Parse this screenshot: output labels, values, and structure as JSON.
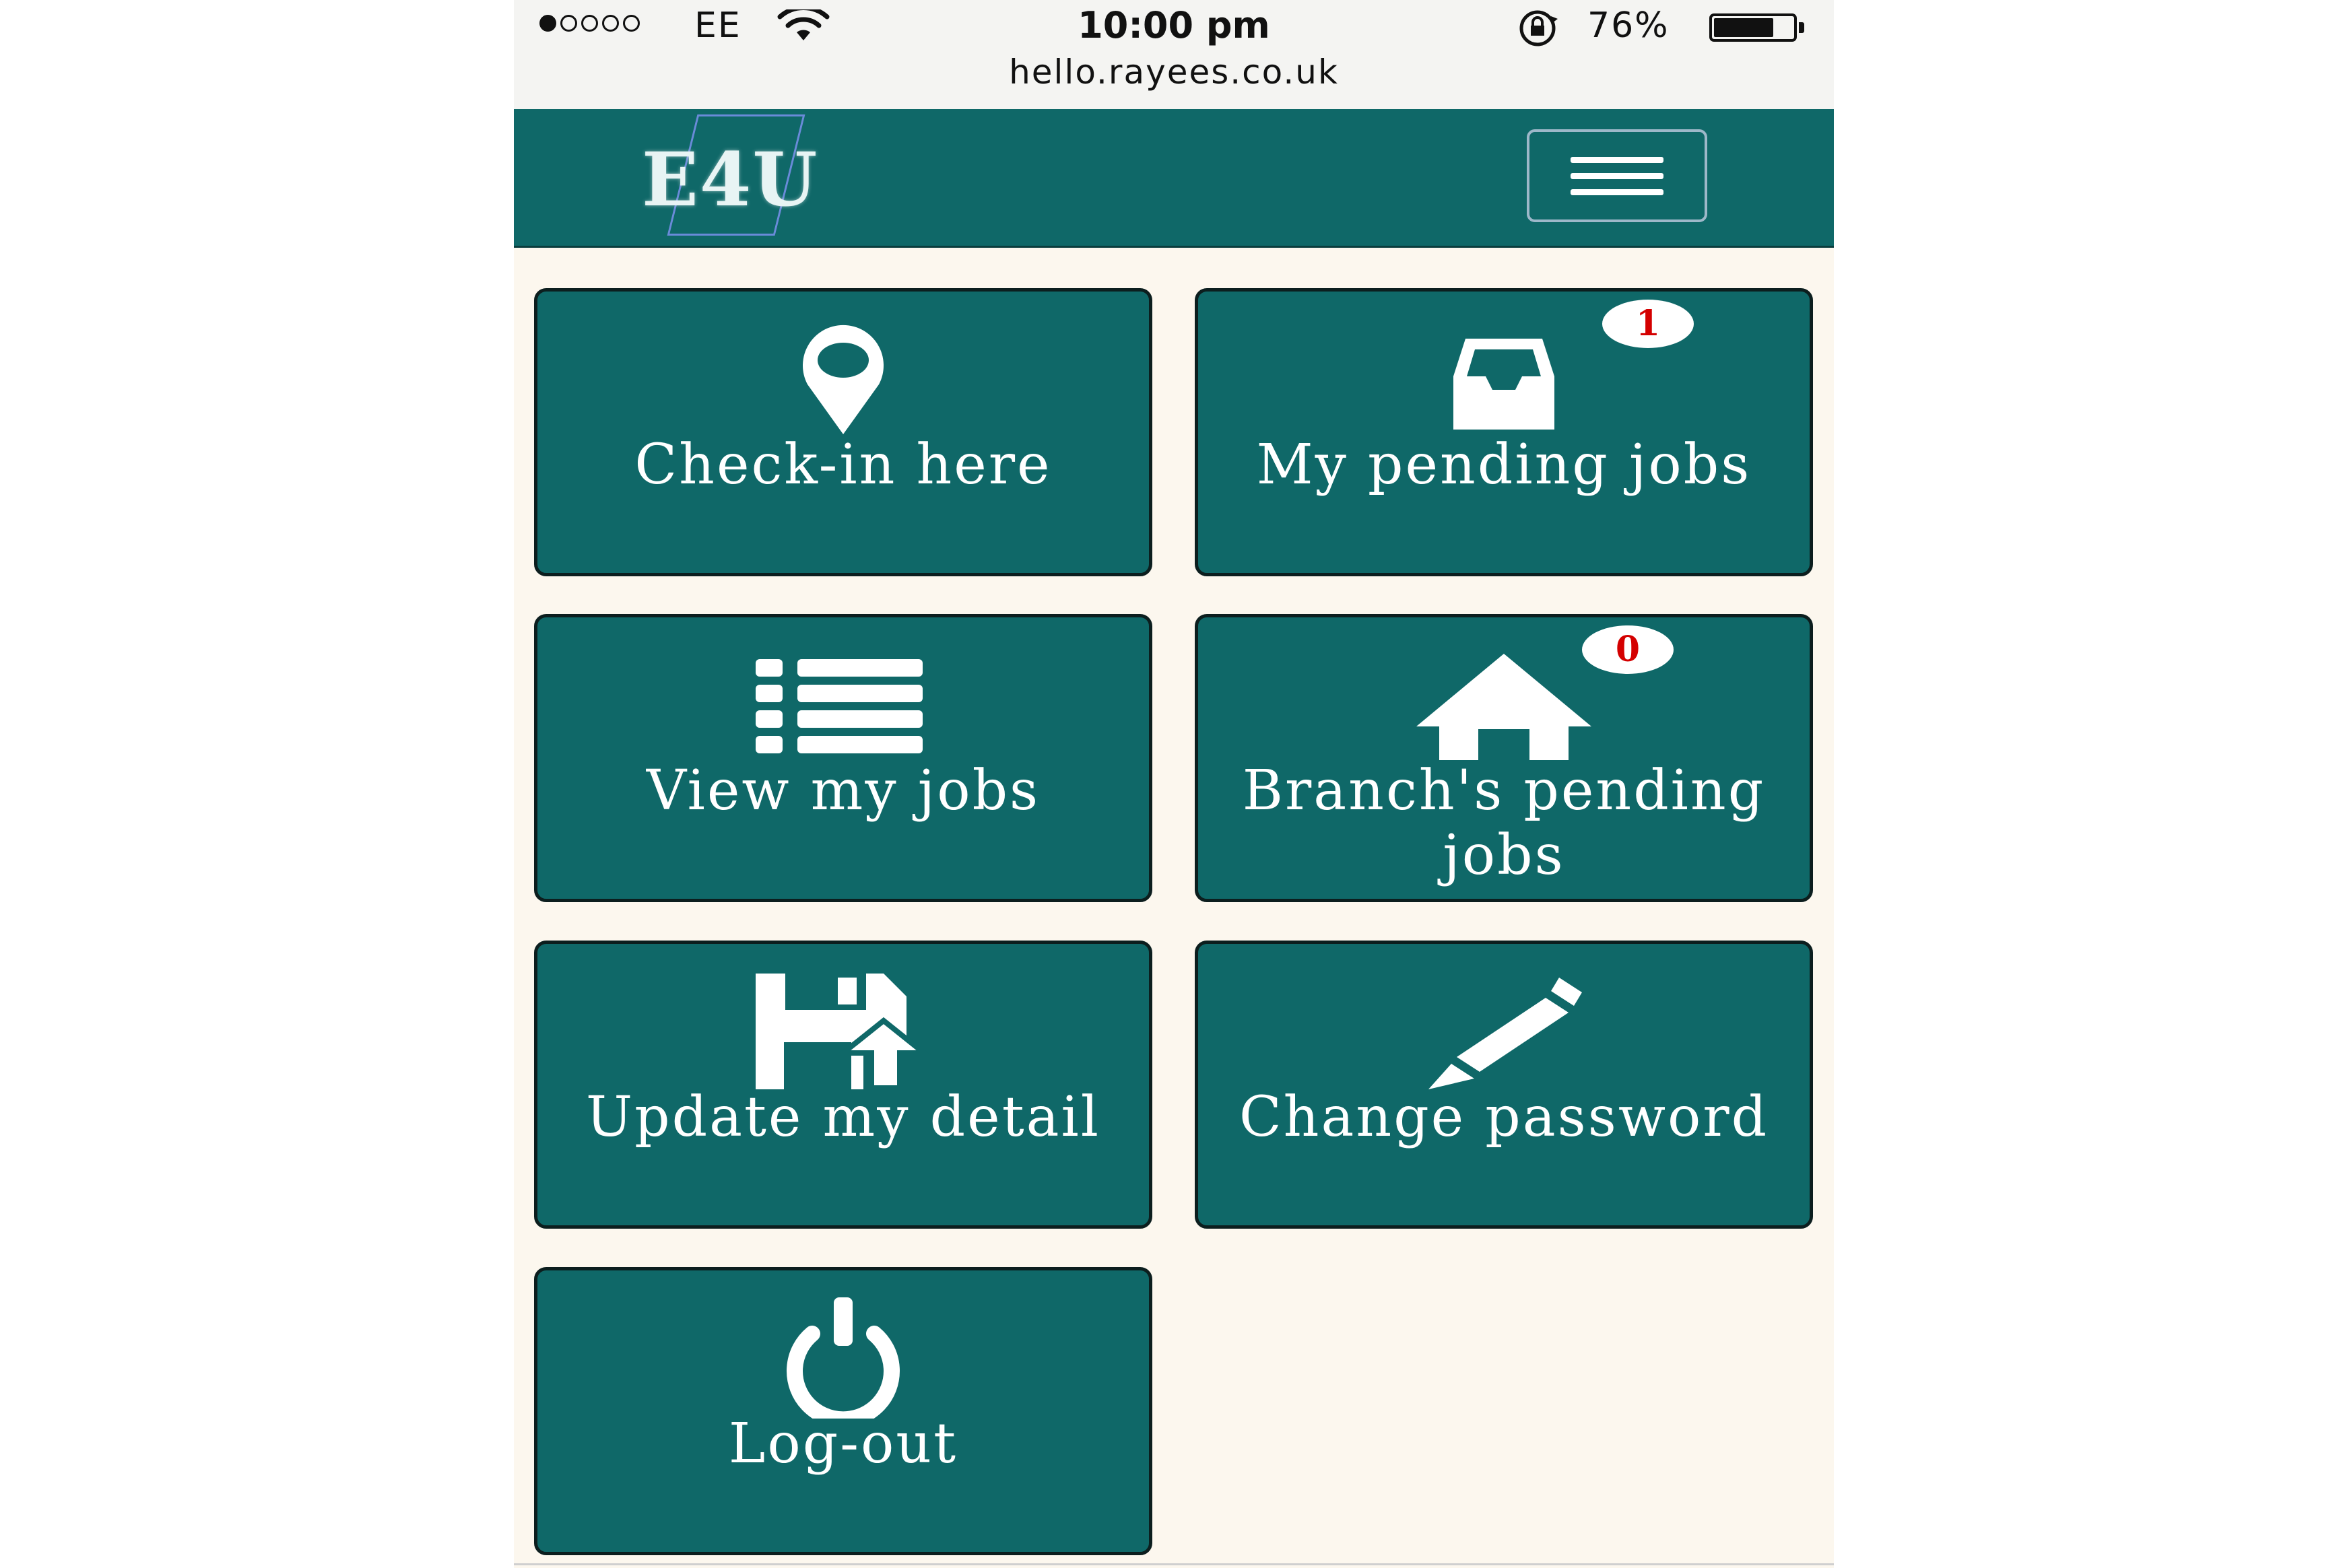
{
  "status_bar": {
    "carrier": "EE",
    "time": "10:00 pm",
    "battery": "76%",
    "battery_level": 0.76,
    "signal_bars": 1,
    "url": "hello.rayees.co.uk"
  },
  "navbar": {
    "logo": "E4U",
    "menu_icon": "hamburger-icon"
  },
  "tiles": [
    {
      "label": "Check-in here",
      "icon": "map-marker-icon"
    },
    {
      "label": "My pending jobs",
      "icon": "inbox-icon",
      "badge": "1"
    },
    {
      "label": "View my jobs",
      "icon": "list-icon"
    },
    {
      "label": "Branch's pending jobs",
      "icon": "home-icon",
      "badge": "0"
    },
    {
      "label": "Update my detail",
      "icon": "save-upload-icon"
    },
    {
      "label": "Change password",
      "icon": "pencil-icon"
    },
    {
      "label": "Log-out",
      "icon": "power-icon"
    }
  ],
  "colors": {
    "primary": "#0f6868",
    "page_background": "#fcf7ee",
    "badge_text": "#d40000"
  }
}
